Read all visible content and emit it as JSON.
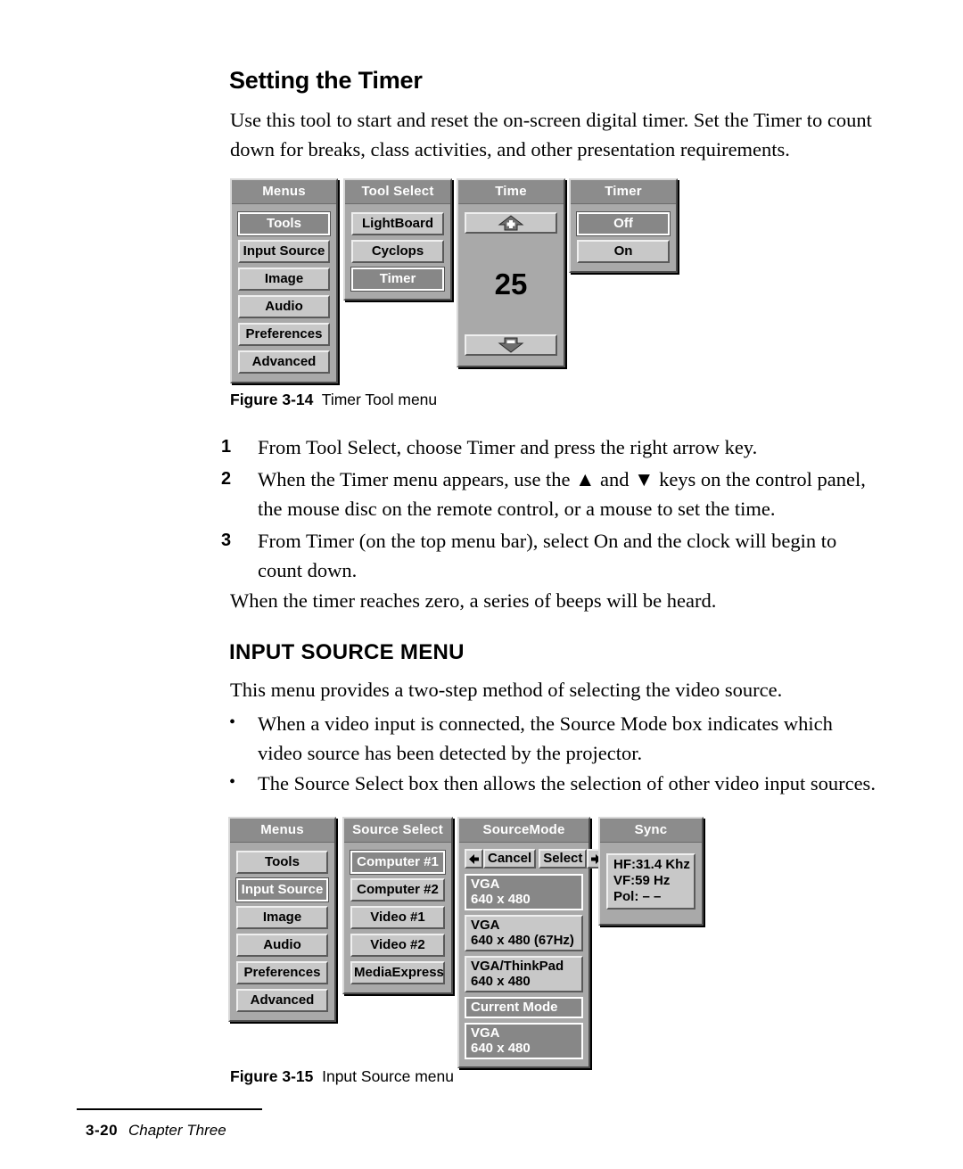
{
  "section": {
    "heading": "Setting the Timer",
    "intro": "Use this tool to start and reset the on-screen digital timer. Set the Timer to count down for breaks, class activities, and other presentation requirements."
  },
  "steps": [
    {
      "num": "1",
      "text": "From Tool Select, choose Timer and press the right arrow key."
    },
    {
      "num": "2",
      "text": "When the Timer menu appears, use the ▲ and ▼ keys on the control panel, the mouse disc on the remote control, or a mouse to set the time."
    },
    {
      "num": "3",
      "text": "From Timer (on the top menu bar), select On and the clock will begin to count down."
    }
  ],
  "after_steps": "When the timer reaches zero, a series of beeps will be heard.",
  "figure_3_14": {
    "caption_label": "Figure 3-14",
    "caption_text": "Timer Tool menu",
    "menus": {
      "title": "Menus",
      "items": [
        {
          "label": "Tools",
          "selected": true
        },
        {
          "label": "Input Source",
          "selected": false
        },
        {
          "label": "Image",
          "selected": false
        },
        {
          "label": "Audio",
          "selected": false
        },
        {
          "label": "Preferences",
          "selected": false
        },
        {
          "label": "Advanced",
          "selected": false
        }
      ]
    },
    "tool_select": {
      "title": "Tool Select",
      "items": [
        {
          "label": "LightBoard",
          "selected": false
        },
        {
          "label": "Cyclops",
          "selected": false
        },
        {
          "label": "Timer",
          "selected": true
        }
      ]
    },
    "time": {
      "title": "Time",
      "increase_icon": "up-arrow-plus-icon",
      "decrease_icon": "down-arrow-minus-icon",
      "value": "25"
    },
    "timer": {
      "title": "Timer",
      "items": [
        {
          "label": "Off",
          "selected": true
        },
        {
          "label": "On",
          "selected": false
        }
      ]
    }
  },
  "input_source_section": {
    "heading": "INPUT SOURCE MENU",
    "intro": "This menu provides a two-step method of selecting the video source.",
    "bullets": [
      "When a video input is connected, the Source Mode box indicates which video source has been detected by the projector.",
      "The Source Select box then allows the selection of other video input sources."
    ]
  },
  "figure_3_15": {
    "caption_label": "Figure 3-15",
    "caption_text": "Input Source menu",
    "menus": {
      "title": "Menus",
      "items": [
        {
          "label": "Tools",
          "selected": false
        },
        {
          "label": "Input Source",
          "selected": true
        },
        {
          "label": "Image",
          "selected": false
        },
        {
          "label": "Audio",
          "selected": false
        },
        {
          "label": "Preferences",
          "selected": false
        },
        {
          "label": "Advanced",
          "selected": false
        }
      ]
    },
    "source_select": {
      "title": "Source Select",
      "items": [
        {
          "label": "Computer #1",
          "selected": true
        },
        {
          "label": "Computer #2",
          "selected": false
        },
        {
          "label": "Video #1",
          "selected": false
        },
        {
          "label": "Video #2",
          "selected": false
        },
        {
          "label": "MediaExpress",
          "selected": false
        }
      ]
    },
    "source_mode": {
      "title": "SourceMode",
      "cancel_label": "Cancel",
      "select_label": "Select",
      "left_icon": "left-arrow-icon",
      "right_icon": "right-arrow-icon",
      "items": [
        {
          "line1": "VGA",
          "line2": "640 x 480",
          "selected": true
        },
        {
          "line1": "VGA",
          "line2": "640 x 480 (67Hz)",
          "selected": false
        },
        {
          "line1": "VGA/ThinkPad",
          "line2": "640 x 480",
          "selected": false
        },
        {
          "line1": "Current Mode",
          "line2": "",
          "selected": true
        },
        {
          "line1": "VGA",
          "line2": "640 x 480",
          "selected": true
        }
      ]
    },
    "sync": {
      "title": "Sync",
      "lines": [
        "HF:31.4 Khz",
        "VF:59 Hz",
        "Pol: – –"
      ]
    }
  },
  "footer": {
    "page": "3-20",
    "chapter": "Chapter Three"
  },
  "colors": {
    "panel_bg": "#a9a9a9",
    "title_bg": "#8c8c8c",
    "button_bg": "#c8c8c8",
    "selected_bg": "#878787",
    "text": "#000000",
    "selected_text": "#ffffff"
  }
}
